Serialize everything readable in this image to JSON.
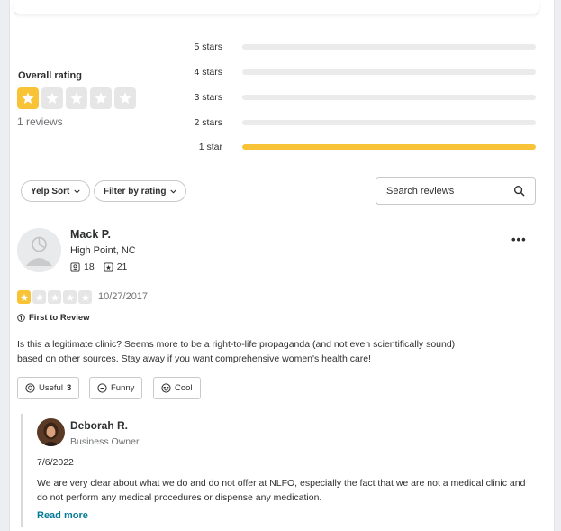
{
  "rating_summary": {
    "overall_label": "Overall rating",
    "rating": 1,
    "max_rating": 5,
    "reviews_count": "1 reviews",
    "star_color": "#f8c336",
    "distribution": [
      {
        "label": "5 stars",
        "fraction": 0
      },
      {
        "label": "4 stars",
        "fraction": 0
      },
      {
        "label": "3 stars",
        "fraction": 0
      },
      {
        "label": "2 stars",
        "fraction": 0
      },
      {
        "label": "1 star",
        "fraction": 1
      }
    ]
  },
  "filters": {
    "sort_label": "Yelp Sort",
    "filter_label": "Filter by rating",
    "search_placeholder": "Search reviews"
  },
  "review": {
    "reviewer_name": "Mack P.",
    "reviewer_location": "High Point, NC",
    "friends_count": "18",
    "reviews_count": "21",
    "rating": 1,
    "date": "10/27/2017",
    "badge": "First to Review",
    "text": "Is this a legitimate clinic?  Seems more to be a right-to-life propaganda (and not even scientifically sound) based on other sources.  Stay away if you want comprehensive women's health care!",
    "reactions": {
      "useful_label": "Useful",
      "useful_count": "3",
      "funny_label": "Funny",
      "cool_label": "Cool"
    }
  },
  "owner_reply": {
    "name": "Deborah R.",
    "role": "Business Owner",
    "date": "7/6/2022",
    "text": "We are very clear about what we do and do not offer at NLFO, especially the fact that we are not a medical clinic and do not perform any medical procedures or dispense any medication.",
    "read_more": "Read more",
    "link_color": "#027a97"
  }
}
